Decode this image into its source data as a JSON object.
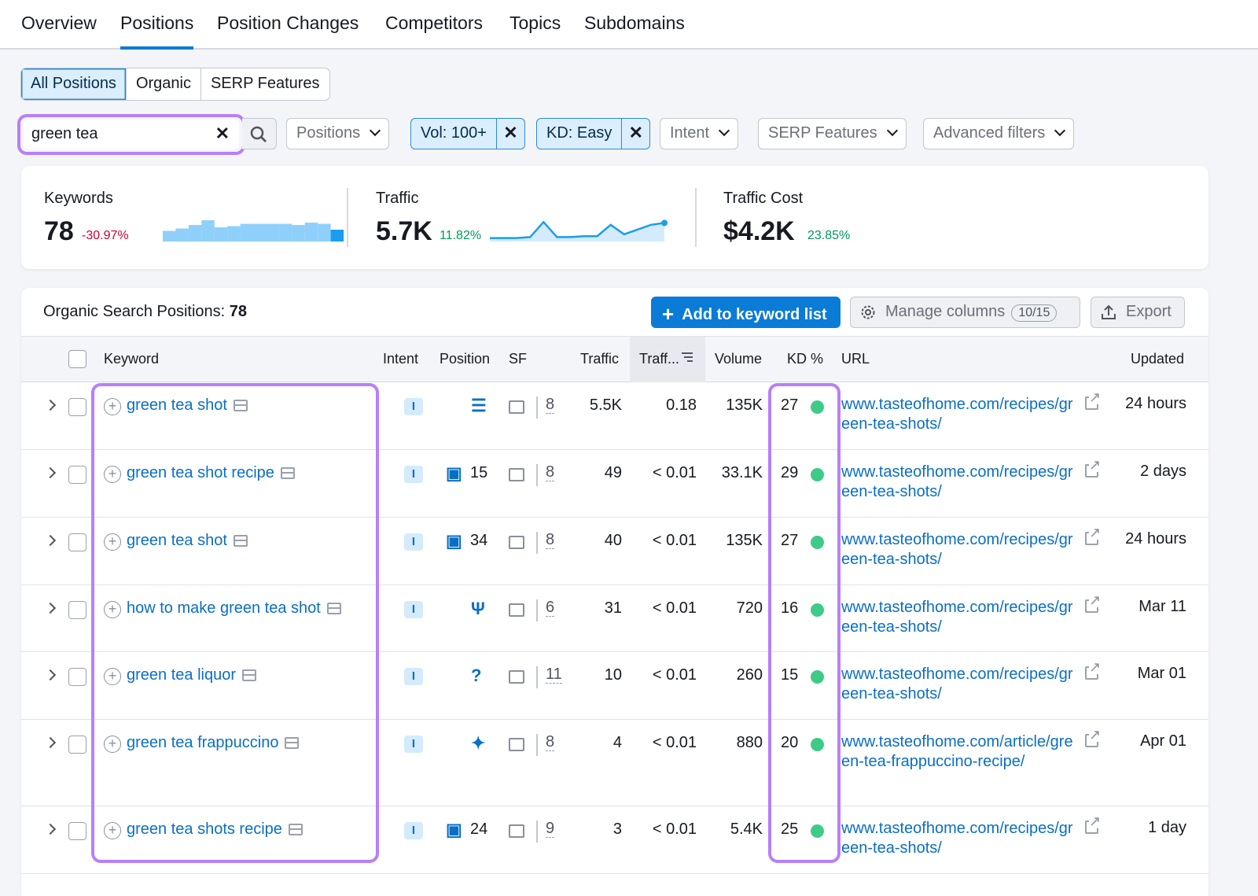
{
  "nav": {
    "tabs": [
      {
        "label": "Overview"
      },
      {
        "label": "Positions"
      },
      {
        "label": "Position Changes"
      },
      {
        "label": "Competitors"
      },
      {
        "label": "Topics"
      },
      {
        "label": "Subdomains"
      }
    ],
    "active": "Positions"
  },
  "segment": {
    "options": [
      "All Positions",
      "Organic",
      "SERP Features"
    ],
    "active": "All Positions"
  },
  "filters": {
    "search_value": "green tea",
    "positions": "Positions",
    "vol_chip": "Vol: 100+",
    "kd_chip": "KD: Easy",
    "intent": "Intent",
    "serp_features": "SERP Features",
    "advanced": "Advanced filters"
  },
  "summary": {
    "keywords": {
      "label": "Keywords",
      "value": "78",
      "change": "-30.97%"
    },
    "traffic": {
      "label": "Traffic",
      "value": "5.7K",
      "change": "11.82%"
    },
    "traffic_cost": {
      "label": "Traffic Cost",
      "value": "$4.2K",
      "change": "23.85%"
    }
  },
  "chart_data": [
    {
      "type": "bar",
      "series": [
        {
          "values": [
            0.45,
            0.55,
            0.7,
            0.9,
            0.6,
            0.65,
            0.75,
            0.75,
            0.75,
            0.75,
            0.7,
            0.8,
            0.75,
            0.5
          ]
        }
      ],
      "title": ""
    },
    {
      "type": "area",
      "series": [
        {
          "values": [
            0.1,
            0.1,
            0.1,
            0.15,
            0.95,
            0.15,
            0.15,
            0.2,
            0.2,
            0.8,
            0.3,
            0.55,
            0.8,
            0.9
          ]
        }
      ],
      "title": ""
    }
  ],
  "colors": {
    "accent": "#0a7bd6",
    "highlight": "#b87ffb",
    "negative": "#d1002f",
    "positive": "#00995a",
    "kd_easy": "#3ecb86"
  },
  "table": {
    "title": "Organic Search Positions:",
    "count": "78",
    "add_button": "Add to keyword list",
    "manage_columns": "Manage columns",
    "manage_badge": "10/15",
    "export": "Export",
    "headers": {
      "keyword": "Keyword",
      "intent": "Intent",
      "position": "Position",
      "sf": "SF",
      "traffic": "Traffic",
      "traffic_pct": "Traff...",
      "volume": "Volume",
      "kd": "KD %",
      "url": "URL",
      "updated": "Updated"
    },
    "rows": [
      {
        "keyword": "green tea shot",
        "intent": "I",
        "sf_icon": "list-icon",
        "position": "",
        "sf": "8",
        "traffic": "5.5K",
        "traffic_pct": "0.18",
        "volume": "135K",
        "kd": "27",
        "url": "www.tasteofhome.com/recipes/green-tea-shots/",
        "updated": "24 hours"
      },
      {
        "keyword": "green tea shot recipe",
        "intent": "I",
        "sf_icon": "image-icon",
        "position": "15",
        "sf": "8",
        "traffic": "49",
        "traffic_pct": "< 0.01",
        "volume": "33.1K",
        "kd": "29",
        "url": "www.tasteofhome.com/recipes/green-tea-shots/",
        "updated": "2 days"
      },
      {
        "keyword": "green tea shot",
        "intent": "I",
        "sf_icon": "image-icon",
        "position": "34",
        "sf": "8",
        "traffic": "40",
        "traffic_pct": "< 0.01",
        "volume": "135K",
        "kd": "27",
        "url": "www.tasteofhome.com/recipes/green-tea-shots/",
        "updated": "24 hours"
      },
      {
        "keyword": "how to make green tea shot",
        "intent": "I",
        "sf_icon": "recipe-icon",
        "position": "",
        "sf": "6",
        "traffic": "31",
        "traffic_pct": "< 0.01",
        "volume": "720",
        "kd": "16",
        "url": "www.tasteofhome.com/recipes/green-tea-shots/",
        "updated": "Mar 11"
      },
      {
        "keyword": "green tea liquor",
        "intent": "I",
        "sf_icon": "question-icon",
        "position": "",
        "sf": "11",
        "traffic": "10",
        "traffic_pct": "< 0.01",
        "volume": "260",
        "kd": "15",
        "url": "www.tasteofhome.com/recipes/green-tea-shots/",
        "updated": "Mar 01"
      },
      {
        "keyword": "green tea frappuccino",
        "intent": "I",
        "sf_icon": "ai-sparkle-icon",
        "position": "",
        "sf": "8",
        "traffic": "4",
        "traffic_pct": "< 0.01",
        "volume": "880",
        "kd": "20",
        "url": "www.tasteofhome.com/article/green-tea-frappuccino-recipe/",
        "updated": "Apr 01"
      },
      {
        "keyword": "green tea shots recipe",
        "intent": "I",
        "sf_icon": "image-icon",
        "position": "24",
        "sf": "9",
        "traffic": "3",
        "traffic_pct": "< 0.01",
        "volume": "5.4K",
        "kd": "25",
        "url": "www.tasteofhome.com/recipes/green-tea-shots/",
        "updated": "1 day"
      }
    ]
  }
}
